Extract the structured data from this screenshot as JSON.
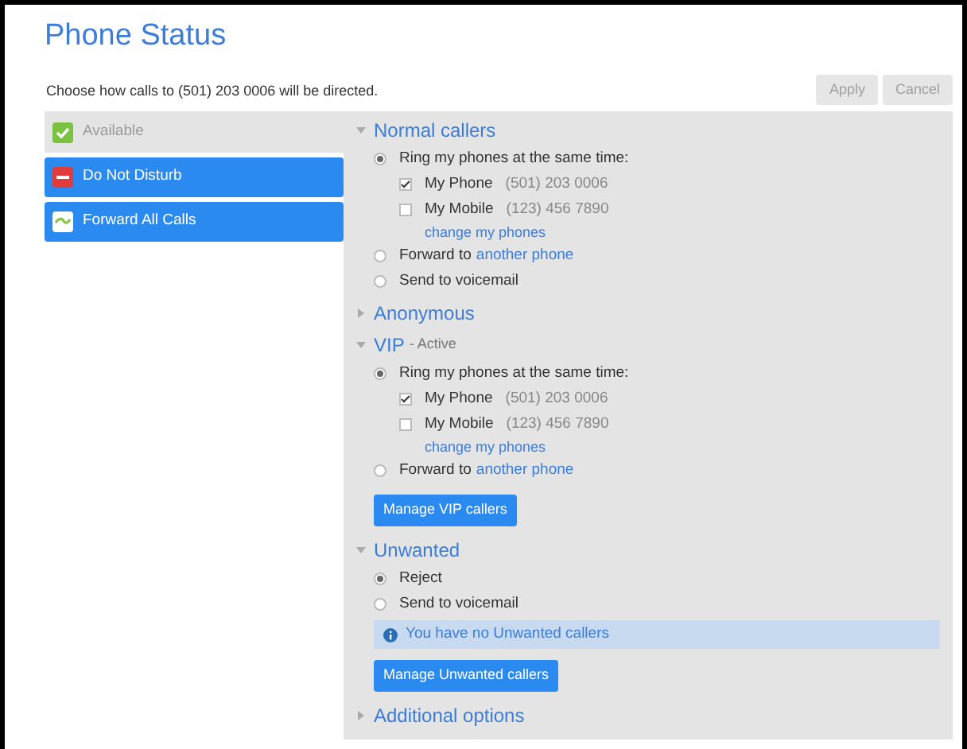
{
  "title": "Phone Status",
  "intro": "Choose how calls to (501) 203 0006 will be directed.",
  "buttons": [
    {
      "label": "Apply",
      "disabled": true
    },
    {
      "label": "Cancel",
      "disabled": true
    }
  ],
  "statuses": [
    {
      "label": "Available",
      "kind": "available",
      "selected": true
    },
    {
      "label": "Do Not Disturb",
      "kind": "dnd",
      "selected": false
    },
    {
      "label": "Forward All Calls",
      "kind": "forward",
      "selected": false
    }
  ],
  "sections": [
    {
      "title": "Normal callers",
      "expanded": true,
      "items": [
        {
          "kind": "radio",
          "label": "Ring my phones at the same time:",
          "selected": true,
          "children": [
            {
              "kind": "checkbox",
              "label": "My Phone",
              "number": "(501) 203 0006",
              "checked": true
            },
            {
              "kind": "checkbox",
              "label": "My Mobile",
              "number": "(123) 456 7890",
              "checked": false
            },
            {
              "kind": "link",
              "label": "change my phones"
            }
          ]
        },
        {
          "kind": "radio",
          "label": "Forward to",
          "link": "another phone",
          "selected": false
        },
        {
          "kind": "radio",
          "label": "Send to voicemail",
          "selected": false
        }
      ]
    },
    {
      "title": "Anonymous",
      "expanded": false
    },
    {
      "title": "VIP",
      "suffix": "- Active",
      "expanded": true,
      "items": [
        {
          "kind": "radio",
          "label": "Ring my phones at the same time:",
          "selected": true,
          "children": [
            {
              "kind": "checkbox",
              "label": "My Phone",
              "number": "(501) 203 0006",
              "checked": true
            },
            {
              "kind": "checkbox",
              "label": "My Mobile",
              "number": "(123) 456 7890",
              "checked": false
            },
            {
              "kind": "link",
              "label": "change my phones"
            }
          ]
        },
        {
          "kind": "radio",
          "label": "Forward to",
          "link": "another phone",
          "selected": false
        },
        {
          "kind": "button",
          "label": "Manage VIP callers"
        }
      ]
    },
    {
      "title": "Unwanted",
      "expanded": true,
      "items": [
        {
          "kind": "radio",
          "label": "Reject",
          "selected": true
        },
        {
          "kind": "radio",
          "label": "Send to voicemail",
          "selected": false
        },
        {
          "kind": "info",
          "label": "You have no Unwanted callers"
        },
        {
          "kind": "button",
          "label": "Manage Unwanted callers"
        }
      ]
    },
    {
      "title": "Additional options",
      "expanded": false
    }
  ]
}
